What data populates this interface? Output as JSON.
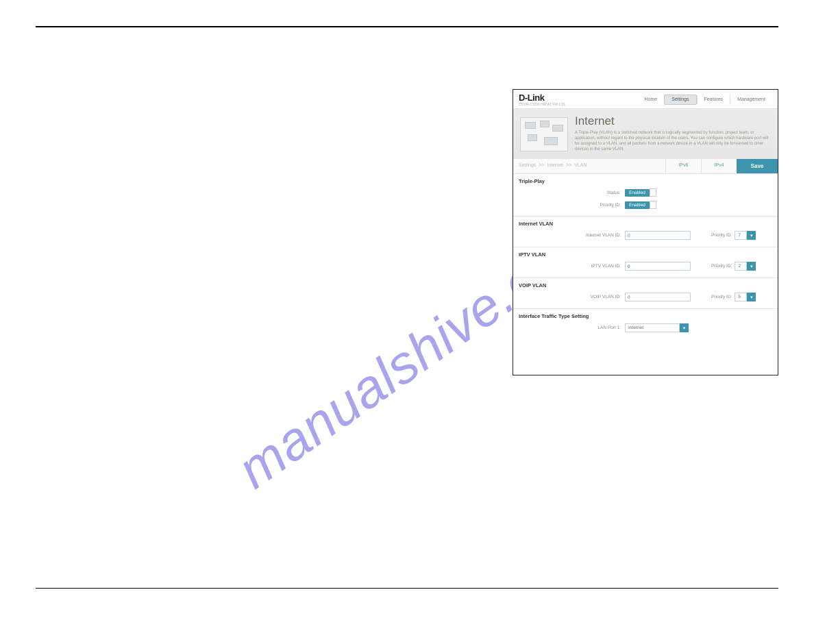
{
  "watermark": "manualshive.com",
  "brand": {
    "logo": "D-Link",
    "model": "COVR-C1200 HW:A1 FW:1.01"
  },
  "nav": {
    "home": "Home",
    "settings": "Settings",
    "features": "Features",
    "management": "Management"
  },
  "hero": {
    "title": "Internet",
    "desc": "A Triple-Play (VLAN) is a switched network that is logically segmented by function, project team, or application, without regard to the physical location of the users. You can configure which hardware port will be assigned to a VLAN, and all packets from a network device in a VLAN will only be forwarded to other devices in the same VLAN."
  },
  "breadcrumb": {
    "a": "Settings",
    "b": "Internet",
    "c": "VLAN",
    "sep": ">>"
  },
  "subtabs": {
    "ipv6": "IPv6",
    "ipv4": "IPv4",
    "save": "Save"
  },
  "sections": {
    "triple": {
      "title": "Triple-Play",
      "status_label": "Status:",
      "status_value": "Enabled",
      "priority_label": "Priority ID:",
      "priority_value": "Enabled"
    },
    "internet_vlan": {
      "title": "Internet VLAN",
      "id_label": "Internet VLAN ID:",
      "id_value": "0",
      "priority_label": "Priority ID:",
      "priority_value": "7"
    },
    "iptv_vlan": {
      "title": "IPTV VLAN",
      "id_label": "IPTV VLAN ID:",
      "id_value": "0",
      "priority_label": "Priority ID:",
      "priority_value": "2"
    },
    "voip_vlan": {
      "title": "VOIP VLAN",
      "id_label": "VOIP VLAN ID:",
      "id_value": "0",
      "priority_label": "Priority ID:",
      "priority_value": "5"
    },
    "interface": {
      "title": "Interface Traffic Type Setting",
      "port_label": "LAN Port 1:",
      "port_value": "Internet"
    }
  }
}
